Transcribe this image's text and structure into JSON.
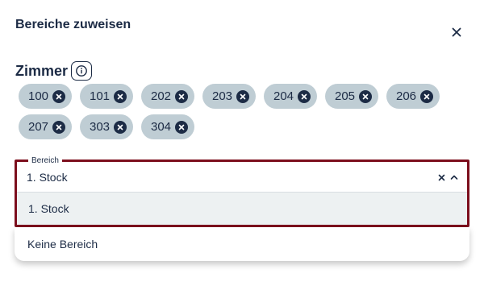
{
  "dialog": {
    "title": "Bereiche zuweisen",
    "close_icon": "close-icon"
  },
  "rooms": {
    "label": "Zimmer",
    "info_icon": "info-icon",
    "chips": [
      {
        "label": "100"
      },
      {
        "label": "101"
      },
      {
        "label": "202"
      },
      {
        "label": "203"
      },
      {
        "label": "204"
      },
      {
        "label": "205"
      },
      {
        "label": "206"
      },
      {
        "label": "207"
      },
      {
        "label": "303"
      },
      {
        "label": "304"
      }
    ]
  },
  "area_select": {
    "legend": "Bereich",
    "value": "1. Stock",
    "clear_icon": "clear-icon",
    "collapse_icon": "chevron-up-icon",
    "options": [
      {
        "label": "1. Stock",
        "highlighted": true
      },
      {
        "label": "Keine Bereich",
        "highlighted": false
      }
    ]
  },
  "colors": {
    "text": "#1c2b45",
    "chip_bg": "#bfcdd4",
    "focus_border": "#7c0e1d",
    "option_highlight": "#edf1f2"
  }
}
